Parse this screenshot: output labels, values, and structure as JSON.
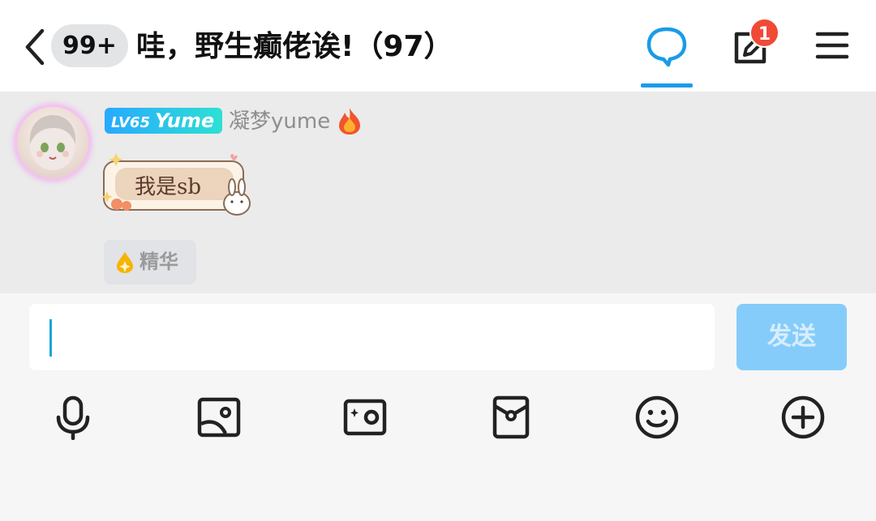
{
  "header": {
    "unread_count": "99+",
    "group_title": "哇，野生癫佬诶!（97）",
    "notification_count": "1",
    "accent_color": "#1a9be8",
    "icons": [
      "back-icon",
      "chat-bubble-icon",
      "edit-post-icon",
      "menu-icon"
    ]
  },
  "message": {
    "level_prefix": "LV65",
    "level_name": "Yume",
    "nickname": "凝梦yume",
    "sticker_text": "我是sb",
    "essence_label": "精华",
    "icons": [
      "fire-icon",
      "essence-drop-icon"
    ]
  },
  "composer": {
    "input_value": "",
    "input_placeholder": "",
    "send_label": "发送",
    "toolbar": [
      "microphone-icon",
      "image-icon",
      "camera-icon",
      "red-envelope-icon",
      "emoji-icon",
      "plus-icon"
    ]
  }
}
